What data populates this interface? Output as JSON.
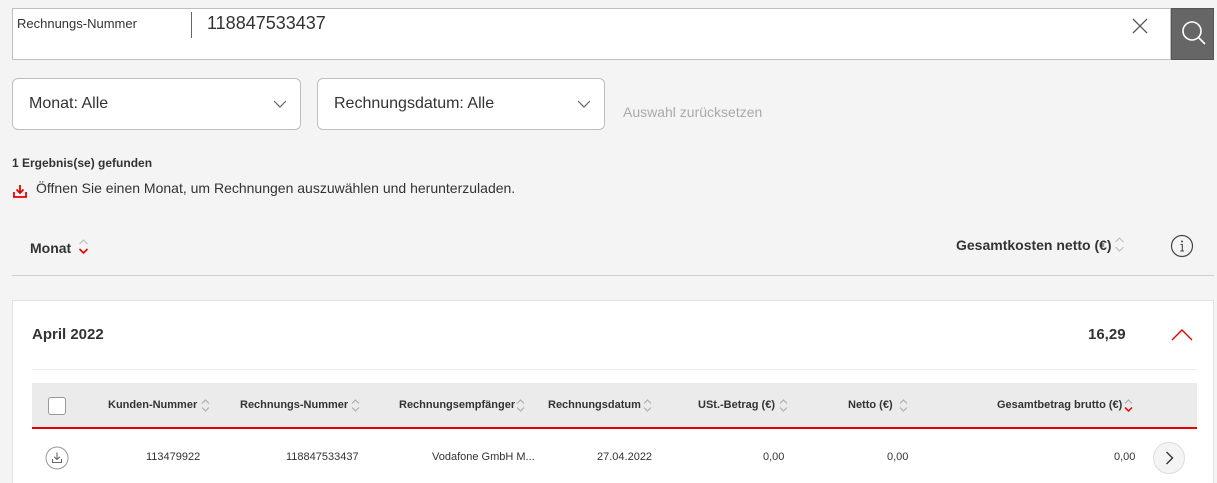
{
  "search": {
    "field_label": "Rechnungs-Nummer",
    "value": "118847533437",
    "clear_icon": "close-icon",
    "search_icon": "search-icon"
  },
  "filters": {
    "month_label": "Monat: Alle",
    "date_label": "Rechnungsdatum: Alle",
    "reset_label": "Auswahl zurücksetzen"
  },
  "results": {
    "count_text": "1 Ergebnis(se) gefunden",
    "hint_text": "Öffnen Sie einen Monat, um Rechnungen auszuwählen und herunterzuladen.",
    "hint_icon": "download-icon"
  },
  "list_header": {
    "month": "Monat",
    "total_net": "Gesamtkosten netto (€)"
  },
  "months": [
    {
      "label": "April 2022",
      "total": "16,29",
      "expanded": true,
      "table": {
        "columns": [
          "Kunden-Nummer",
          "Rechnungs-Nummer",
          "Rechnungsempfänger",
          "Rechnungsdatum",
          "USt.-Betrag (€)",
          "Netto (€)",
          "Gesamtbetrag brutto (€)"
        ],
        "rows": [
          {
            "customer_number": "113479922",
            "invoice_number": "118847533437",
            "recipient": "Vodafone GmbH M...",
            "invoice_date": "27.04.2022",
            "vat": "0,00",
            "net": "0,00",
            "gross": "0,00"
          }
        ]
      }
    }
  ],
  "colors": {
    "accent": "#e60000",
    "search_button": "#666666",
    "background": "#f4f4f4"
  }
}
